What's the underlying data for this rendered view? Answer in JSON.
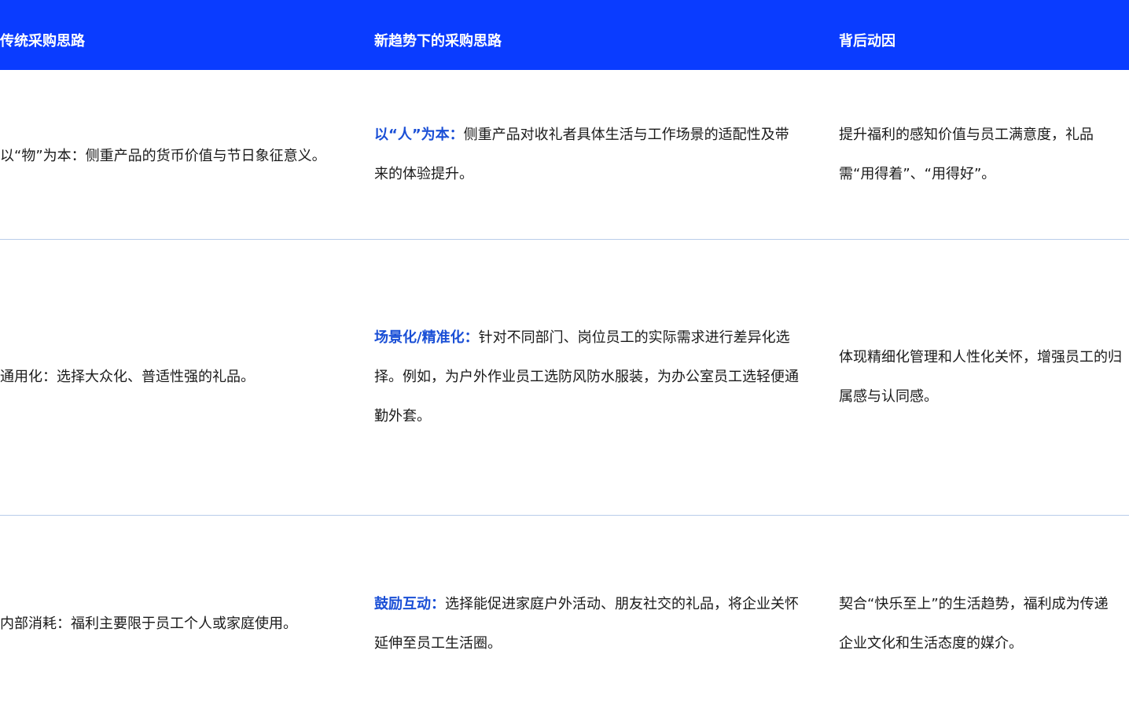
{
  "header": {
    "col1": "传统采购思路",
    "col2": "新趋势下的采购思路",
    "col3": "背后动因"
  },
  "rows": [
    {
      "traditional": "以“物”为本：侧重产品的货币价值与节日象征意义。",
      "new_label": "以“人”为本：",
      "new_text": "侧重产品对收礼者具体生活与工作场景的适配性及带来的体验提升。",
      "reason": "提升福利的感知价值与员工满意度，礼品需“用得着”、“用得好”。"
    },
    {
      "traditional": "通用化：选择大众化、普适性强的礼品。",
      "new_label": "场景化/精准化：",
      "new_text": "针对不同部门、岗位员工的实际需求进行差异化选择。例如，为户外作业员工选防风防水服装，为办公室员工选轻便通勤外套。",
      "reason": "体现精细化管理和人性化关怀，增强员工的归属感与认同感。"
    },
    {
      "traditional": "内部消耗：福利主要限于员工个人或家庭使用。",
      "new_label": "鼓励互动：",
      "new_text": "选择能促进家庭户外活动、朋友社交的礼品，将企业关怀延伸至员工生活圈。",
      "reason": "契合“快乐至上”的生活趋势，福利成为传递企业文化和生活态度的媒介。"
    }
  ],
  "colors": {
    "header_bg": "#0a3cff",
    "highlight": "#1a4fd6",
    "divider": "#b9cdea"
  }
}
